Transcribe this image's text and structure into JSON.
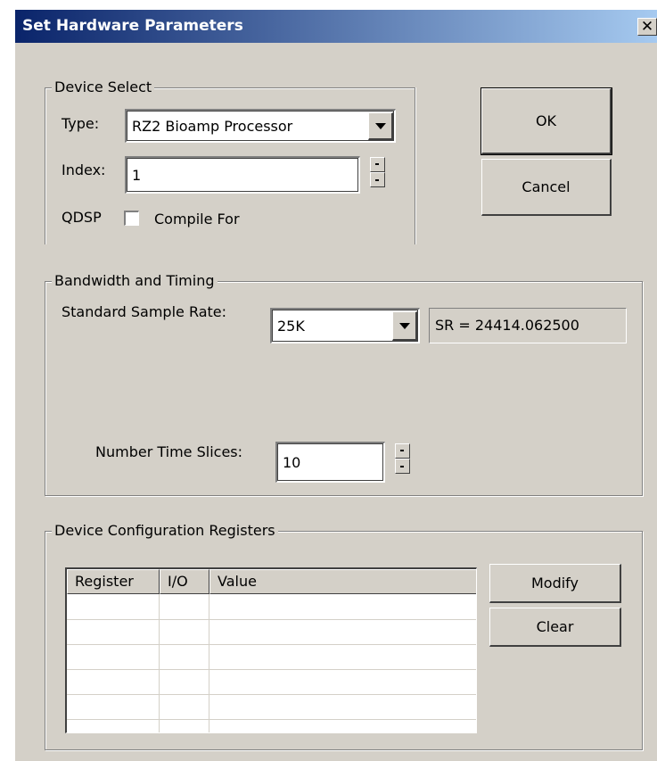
{
  "window": {
    "title": "Set Hardware Parameters",
    "close_glyph": "✕"
  },
  "device_select": {
    "legend": "Device Select",
    "type_label": "Type:",
    "type_value": "RZ2  Bioamp Processor",
    "index_label": "Index:",
    "index_value": "1",
    "qdsp_label": "QDSP",
    "compile_for_label": "Compile For",
    "compile_for_checked": false
  },
  "buttons": {
    "ok": "OK",
    "cancel": "Cancel",
    "modify": "Modify",
    "clear": "Clear"
  },
  "bandwidth": {
    "legend": "Bandwidth and Timing",
    "sample_rate_label": "Standard Sample Rate:",
    "sample_rate_value": "25K",
    "sr_display": "SR = 24414.062500",
    "time_slices_label": "Number Time Slices:",
    "time_slices_value": "10"
  },
  "registers": {
    "legend": "Device Configuration Registers",
    "columns": [
      "Register",
      "I/O",
      "Value"
    ],
    "rows": []
  },
  "icons": {
    "dropdown": "chevron-down-icon",
    "spin_up": "spin-up-icon",
    "spin_down": "spin-down-icon",
    "close": "close-icon"
  },
  "colors": {
    "dialog_face": "#d4d0c8",
    "titlebar_start": "#0a246a",
    "titlebar_end": "#a6caf0"
  }
}
